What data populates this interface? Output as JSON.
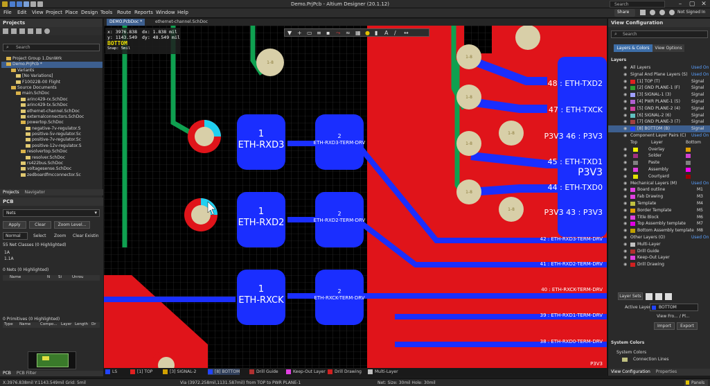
{
  "titlebar": {
    "title": "Demo.PrjPcb - Altium Designer (20.1.12)",
    "search": "Search",
    "share": "Share",
    "user": "Not Signed In"
  },
  "menu": [
    "File",
    "Edit",
    "View",
    "Project",
    "Place",
    "Design",
    "Tools",
    "Route",
    "Reports",
    "Window",
    "Help"
  ],
  "projects": {
    "title": "Projects",
    "search": "Search",
    "tree": [
      {
        "label": "Project Group 1.DsnWrk",
        "indent": 1,
        "type": "folder"
      },
      {
        "label": "Demo.PrjPcb *",
        "indent": 1,
        "type": "folder",
        "selected": true
      },
      {
        "label": "Variants",
        "indent": 2,
        "type": "folder"
      },
      {
        "label": "[No Variations]",
        "indent": 3,
        "type": "doc"
      },
      {
        "label": "F10022B-00 Flight",
        "indent": 3,
        "type": "doc"
      },
      {
        "label": "Source Documents",
        "indent": 2,
        "type": "folder"
      },
      {
        "label": "main.SchDoc",
        "indent": 3,
        "type": "folder"
      },
      {
        "label": "arinc429-rx.SchDoc",
        "indent": 4,
        "type": "doc"
      },
      {
        "label": "arinc429-tx.SchDoc",
        "indent": 4,
        "type": "doc"
      },
      {
        "label": "ethernet-channel.SchDoc",
        "indent": 4,
        "type": "doc"
      },
      {
        "label": "externalconnectors.SchDoc",
        "indent": 4,
        "type": "doc"
      },
      {
        "label": "powertop.SchDoc",
        "indent": 4,
        "type": "folder"
      },
      {
        "label": "negative-7v-regulator.S",
        "indent": 5,
        "type": "doc"
      },
      {
        "label": "positive-5v-regulator.Sc",
        "indent": 5,
        "type": "doc"
      },
      {
        "label": "positive-7v-regulator.Sc",
        "indent": 5,
        "type": "doc"
      },
      {
        "label": "positive-12v-regulator.S",
        "indent": 5,
        "type": "doc"
      },
      {
        "label": "resolvertop.SchDoc",
        "indent": 4,
        "type": "folder"
      },
      {
        "label": "resolver.SchDoc",
        "indent": 5,
        "type": "doc"
      },
      {
        "label": "rs422bus.SchDoc",
        "indent": 4,
        "type": "doc"
      },
      {
        "label": "voltagesense.SchDoc",
        "indent": 4,
        "type": "doc"
      },
      {
        "label": "zedboardfmcconnector.Sc",
        "indent": 4,
        "type": "doc"
      }
    ],
    "tabs": [
      "Projects",
      "Navigator"
    ]
  },
  "pcb": {
    "title": "PCB",
    "dropdown": "Nets",
    "apply": "Apply",
    "clear": "Clear",
    "zoom_level": "Zoom Level...",
    "normal": "Normal",
    "select": "Select",
    "zoom": "Zoom",
    "clear_existing": "Clear Existin",
    "net_classes": "55 Net Classes (0 Highlighted)",
    "nets_rows": [
      "1A",
      "1.1A"
    ],
    "nets_header": "0 Nets (0 Highlighted)",
    "net_cols": [
      "Name",
      "N",
      "Si",
      "Unrou"
    ],
    "primitives_header": "0 Primitives (0 Highlighted)",
    "prim_cols": [
      "Type",
      "Name",
      "Compo...",
      "Layer",
      "Length",
      "Dr"
    ],
    "bottom_tabs": [
      "PCB",
      "PCB Filter"
    ]
  },
  "doctabs": [
    "DEMO.PcbDoc *",
    "ethernet-channel.SchDoc"
  ],
  "hud": {
    "x": "x: 3976.838",
    "dx": "dx:  1.838 mil",
    "y": "y: 1143.549",
    "dy": "dy:  48.549 mil",
    "layer": "BOTTOM",
    "snap": "Snap: 5mil"
  },
  "pads_left": [
    {
      "num": "1",
      "net": "ETH-RXD3"
    },
    {
      "num": "1",
      "net": "ETH-RXD2"
    },
    {
      "num": "1",
      "net": "ETH-RXCK"
    }
  ],
  "pads_mid": [
    {
      "num": "2",
      "net": "ETH-RXD3-TERM-DRV"
    },
    {
      "num": "2",
      "net": "ETH-RXD2-TERM-DRV"
    },
    {
      "num": "2",
      "net": "ETH-RXCK-TERM-DRV"
    }
  ],
  "right_labels": [
    "48 : ETH-TXD2",
    "47 : ETH-TXCK",
    "P3V3  46 : P3V3",
    "45 : ETH-TXD1",
    "P3V3",
    "44 : ETH-TXD0",
    "P3V3  43 : P3V3",
    "42 : ETH-RXD3-TERM-DRV",
    "41 : ETH-RXD2-TERM-DRV",
    "40 : ETH-RXCK-TERM-DRV",
    "39 : ETH-RXD1-TERM-DRV",
    "38 : ETH-RXD0-TERM-DRV",
    "P3V3"
  ],
  "layer_tabs": [
    {
      "label": "LS",
      "color": "#2244ff"
    },
    {
      "label": "[1] TOP",
      "color": "#e02020"
    },
    {
      "label": "[3] SIGNAL-2",
      "color": "#d0a000"
    },
    {
      "label": "[8] BOTTOM",
      "color": "#2244ff"
    },
    {
      "label": "Drill Guide",
      "color": "#b03030"
    },
    {
      "label": "Keep-Out Layer",
      "color": "#e040e0"
    },
    {
      "label": "Drill Drawing",
      "color": "#d02020"
    },
    {
      "label": "Multi-Layer",
      "color": "#c0c0c0"
    }
  ],
  "status": {
    "left": "X:3976.838mil Y:1143.549mil  Grid: 5mil",
    "mid": "Via (3972.258mil,1131.587mil) from TOP to PWR PLANE-1",
    "right": "Net: Size: 30mil Hole: 30mil",
    "panels": "Panels"
  },
  "viewconfig": {
    "title": "View Configuration",
    "search": "Search",
    "tabs": [
      "Layers & Colors",
      "View Options"
    ],
    "layers_header": "Layers",
    "all_layers": "All Layers",
    "used_on": "Used On",
    "signal_group": "Signal And Plane Layers (S)",
    "signal_used": "Used On",
    "signals": [
      {
        "name": "[1] TOP (T)",
        "color": "#e02020",
        "type": "Signal"
      },
      {
        "name": "[2] GND PLANE-1 (F)",
        "color": "#30a030",
        "type": "Signal"
      },
      {
        "name": "[3] SIGNAL-1 (3)",
        "color": "#a0a0ff",
        "type": "Signal"
      },
      {
        "name": "[4] PWR PLANE-1 (5)",
        "color": "#b060d0",
        "type": "Signal"
      },
      {
        "name": "[5] GND PLANE-2 (4)",
        "color": "#d040a0",
        "type": "Signal"
      },
      {
        "name": "[6] SIGNAL-2 (6)",
        "color": "#60c0c0",
        "type": "Signal"
      },
      {
        "name": "[7] GND PLANE-3 (7)",
        "color": "#a04040",
        "type": "Signal"
      },
      {
        "name": "[8] BOTTOM (B)",
        "color": "#2244ff",
        "type": "Signal",
        "selected": true
      }
    ],
    "comp_group": "Component Layer Pairs (C)",
    "comp_used": "Used On",
    "comp_cols": [
      "Top",
      "Layer",
      "Bottom"
    ],
    "comps": [
      {
        "name": "Overlay",
        "top": "#f0f000",
        "bottom": "#e0a000"
      },
      {
        "name": "Solder",
        "top": "#a03080",
        "bottom": "#d040d0"
      },
      {
        "name": "Paste",
        "top": "#808080",
        "bottom": "#808080"
      },
      {
        "name": "Assembly",
        "top": "#e040e0",
        "bottom": "#ff00ff"
      },
      {
        "name": "Courtyard",
        "top": "#e0e000",
        "bottom": "#a00000"
      }
    ],
    "mech_group": "Mechanical Layers (M)",
    "mech_used": "Used On",
    "mechs": [
      {
        "name": "Board outline",
        "color": "#e040e0",
        "code": "M1"
      },
      {
        "name": "Fab Drawing",
        "color": "#e040e0",
        "code": "M3"
      },
      {
        "name": "Template",
        "color": "#c0c040",
        "code": "M4"
      },
      {
        "name": "Border Template",
        "color": "#e0a000",
        "code": "M5"
      },
      {
        "name": "Title Block",
        "color": "#e040e0",
        "code": "M6"
      },
      {
        "name": "Top Assembly template",
        "color": "#e000e0",
        "code": "M7"
      },
      {
        "name": "Bottom Assembly template",
        "color": "#c0a000",
        "code": "M8"
      }
    ],
    "other_group": "Other Layers (O)",
    "other_used": "Used On",
    "others": [
      {
        "name": "Multi-Layer",
        "color": "#c0c0c0"
      },
      {
        "name": "Drill Guide",
        "color": "#b03030"
      },
      {
        "name": "Keep-Out Layer",
        "color": "#e040e0"
      },
      {
        "name": "Drill Drawing",
        "color": "#d02020"
      }
    ],
    "layer_sets": "Layer Sets",
    "active_layer_label": "Active Layer",
    "active_layer": "BOTTOM",
    "view_from": "View Fro... / Pl...",
    "import": "Import",
    "export": "Export",
    "sys_colors": "System Colors",
    "sys_sub": "System Colors",
    "connection_lines": "Connection Lines",
    "bottom_tabs": [
      "View Configuration",
      "Properties"
    ]
  }
}
